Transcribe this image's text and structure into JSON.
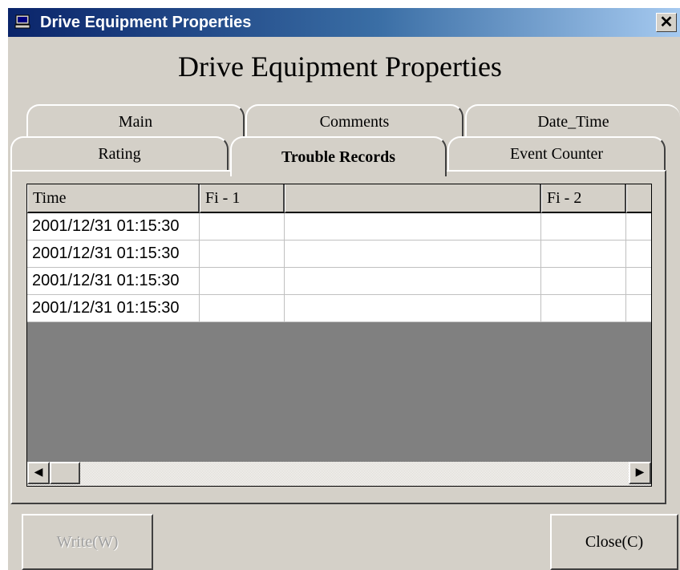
{
  "window": {
    "title": "Drive Equipment Properties",
    "close_glyph": "✕"
  },
  "heading": "Drive Equipment Properties",
  "tabs": {
    "main": "Main",
    "comments": "Comments",
    "date_time": "Date_Time",
    "rating": "Rating",
    "trouble_records": "Trouble Records",
    "event_counter": "Event Counter",
    "active": "Trouble Records"
  },
  "table": {
    "columns": [
      "Time",
      "Fi - 1",
      "",
      "Fi - 2",
      ""
    ],
    "rows": [
      [
        "2001/12/31 01:15:30",
        "",
        "",
        "",
        ""
      ],
      [
        "2001/12/31 01:15:30",
        "",
        "",
        "",
        ""
      ],
      [
        "2001/12/31 01:15:30",
        "",
        "",
        "",
        ""
      ],
      [
        "2001/12/31 01:15:30",
        "",
        "",
        "",
        ""
      ]
    ]
  },
  "scrollbar": {
    "left_arrow": "◀",
    "right_arrow": "▶"
  },
  "buttons": {
    "write": "Write(W)",
    "close": "Close(C)",
    "write_enabled": false
  },
  "colors": {
    "titlebar_start": "#0a246a",
    "titlebar_end": "#a6caf0",
    "face": "#d4d0c8",
    "grid_empty": "#808080"
  }
}
